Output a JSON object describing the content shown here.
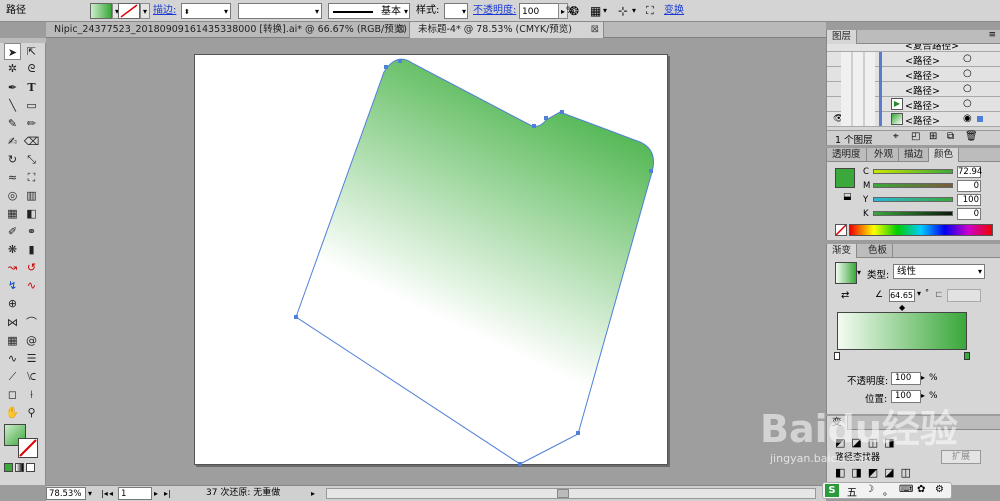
{
  "control": {
    "object_type": "路径",
    "stroke_label": "描边:",
    "stroke_style": "基本",
    "style_label": "样式:",
    "opacity_label": "不透明度:",
    "opacity_value": "100",
    "opacity_unit": "%",
    "transform_link": "变换"
  },
  "tabs": [
    {
      "label": "Nipic_24377523_20180909161435338000 [转换].ai* @ 66.67% (RGB/预览)"
    },
    {
      "label": "未标题-4* @ 78.53% (CMYK/预览)"
    }
  ],
  "status": {
    "zoom": "78.53%",
    "page": "1",
    "undo_text": "37 次还原: 无重做"
  },
  "layers": {
    "title": "图层",
    "items": [
      "<复合路径>",
      "<路径>",
      "<路径>",
      "<路径>",
      "<路径>",
      "<路径>"
    ],
    "count_label": "1 个图层"
  },
  "color_panel": {
    "tabs": [
      "透明度",
      "外观",
      "描边",
      "颜色"
    ],
    "channels": [
      {
        "name": "C",
        "value": "72.94"
      },
      {
        "name": "M",
        "value": "0"
      },
      {
        "name": "Y",
        "value": "100"
      },
      {
        "name": "K",
        "value": "0"
      }
    ],
    "fill_color": "#3aa83a"
  },
  "gradient_panel": {
    "tabs": [
      "渐变",
      "色板"
    ],
    "type_label": "类型:",
    "type_value": "线性",
    "angle_value": "64.65",
    "angle_unit": "°",
    "opacity_label": "不透明度:",
    "opacity_value": "100",
    "position_label": "位置:",
    "position_value": "100",
    "percent": "%"
  },
  "bottom_panel": {
    "title": "路径查找器",
    "expand_button": "扩展"
  },
  "watermark": {
    "logo": "Baidu经验",
    "url": "jingyan.baidu.com"
  },
  "ime": {
    "items": [
      "五",
      "☽",
      "。"
    ]
  }
}
